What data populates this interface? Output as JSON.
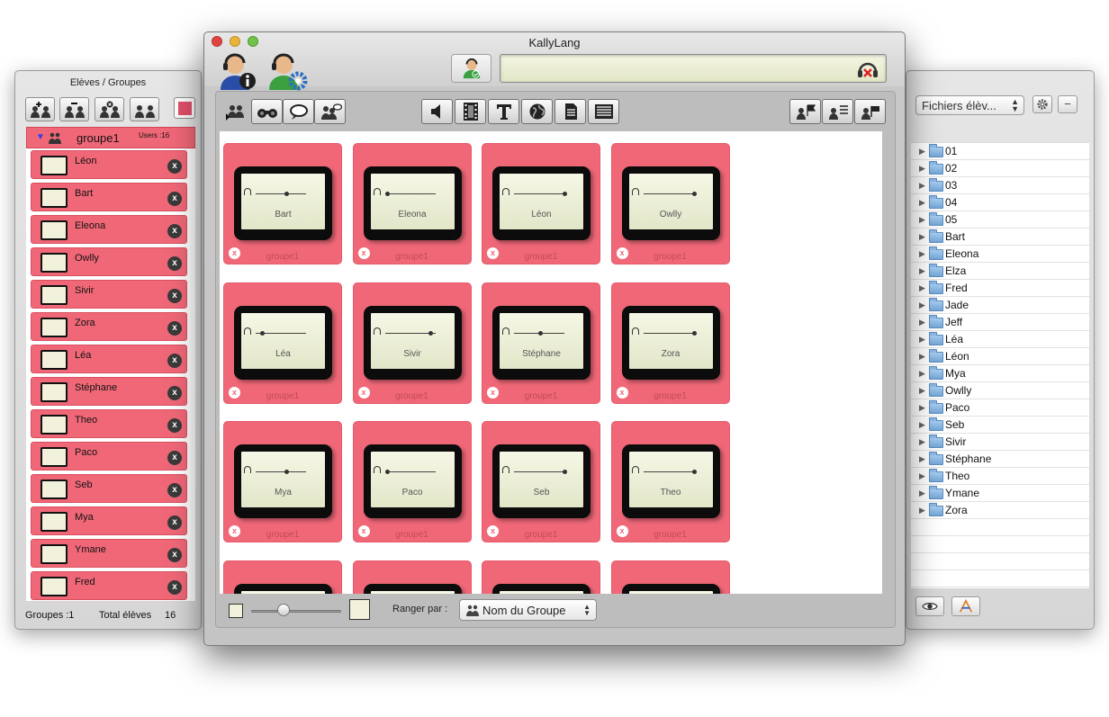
{
  "left_panel": {
    "title": "Elèves / Groupes",
    "group": {
      "name": "groupe1",
      "users": "Users :16"
    },
    "students": [
      "Léon",
      "Bart",
      "Eleona",
      "Owlly",
      "Sivir",
      "Zora",
      "Léa",
      "Stéphane",
      "Theo",
      "Paco",
      "Seb",
      "Mya",
      "Ymane",
      "Fred"
    ],
    "remove_glyph": "x",
    "footer": {
      "groups": "Groupes :1",
      "total_label": "Total élèves",
      "total_value": "16"
    }
  },
  "main_window": {
    "title": "KallyLang",
    "cards": [
      {
        "name": "Bart",
        "group": "groupe1",
        "progress": 0.6
      },
      {
        "name": "Eleona",
        "group": "groupe1",
        "progress": 0.0
      },
      {
        "name": "Léon",
        "group": "groupe1",
        "progress": 1.0
      },
      {
        "name": "Owlly",
        "group": "groupe1",
        "progress": 1.0
      },
      {
        "name": "Léa",
        "group": "groupe1",
        "progress": 0.1
      },
      {
        "name": "Sivir",
        "group": "groupe1",
        "progress": 0.9
      },
      {
        "name": "Stéphane",
        "group": "groupe1",
        "progress": 0.5
      },
      {
        "name": "Zora",
        "group": "groupe1",
        "progress": 1.0
      },
      {
        "name": "Mya",
        "group": "groupe1",
        "progress": 0.6
      },
      {
        "name": "Paco",
        "group": "groupe1",
        "progress": 0.0
      },
      {
        "name": "Seb",
        "group": "groupe1",
        "progress": 1.0
      },
      {
        "name": "Theo",
        "group": "groupe1",
        "progress": 1.0
      },
      {
        "name": "",
        "group": "",
        "progress": 0
      },
      {
        "name": "",
        "group": "",
        "progress": 0
      },
      {
        "name": "",
        "group": "",
        "progress": 0
      },
      {
        "name": "",
        "group": "",
        "progress": 0
      }
    ],
    "sort_label": "Ranger par :",
    "sort_value": "Nom du Groupe"
  },
  "right_panel": {
    "popup_value": "Fichiers élèv...",
    "minus_label": "−",
    "folders": [
      "01",
      "02",
      "03",
      "04",
      "05",
      "Bart",
      "Eleona",
      "Elza",
      "Fred",
      "Jade",
      "Jeff",
      "Léa",
      "Léon",
      "Mya",
      "Owlly",
      "Paco",
      "Seb",
      "Sivir",
      "Stéphane",
      "Theo",
      "Ymane",
      "Zora"
    ]
  },
  "colors": {
    "card": "#f06878",
    "screen": "#f2f2dc",
    "folder": "#7fb0e0"
  },
  "icons": [
    "add-group-icon",
    "remove-group-icon",
    "delete-group-icon",
    "group-icon",
    "binoculars-icon",
    "chat-icon",
    "speaker-icon",
    "film-icon",
    "text-icon",
    "globe-icon",
    "document-icon",
    "list-icon",
    "gear-icon",
    "eye-icon",
    "app-icon",
    "headset-icon"
  ]
}
